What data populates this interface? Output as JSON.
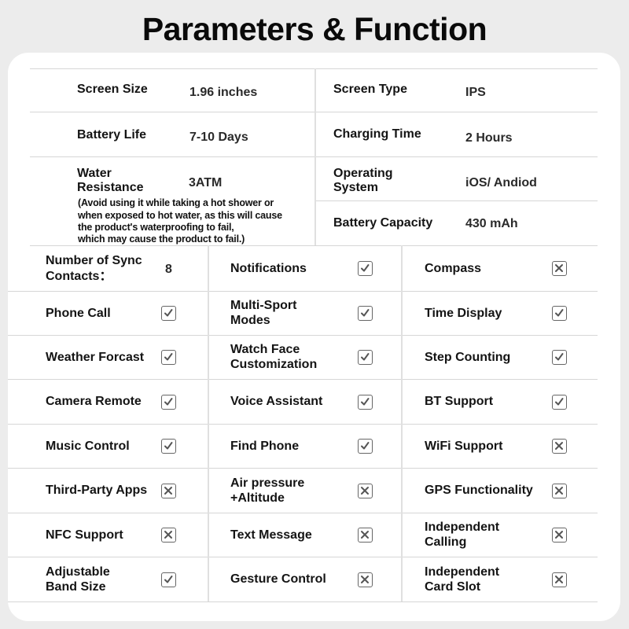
{
  "title": "Parameters & Function",
  "specs": [
    {
      "label": "Screen Size",
      "value": "1.96 inches"
    },
    {
      "label": "Screen Type",
      "value": "IPS"
    },
    {
      "label": "Battery Life",
      "value": "7-10 Days"
    },
    {
      "label": "Charging Time",
      "value": "2 Hours"
    },
    {
      "label": "Water Resistance",
      "label_lines": [
        "Water",
        "Resistance"
      ],
      "value": "3ATM",
      "note_lines": [
        "(Avoid using it while taking a hot shower or",
        "when exposed to hot water, as this will cause",
        "the product's waterproofing to fail,",
        "which may cause the product to fail.)"
      ]
    },
    {
      "label": "Operating System",
      "label_lines": [
        "Operating",
        "System"
      ],
      "value": "iOS/ Andiod"
    },
    {
      "label": "Battery Capacity",
      "value": "430 mAh"
    }
  ],
  "sync_contacts": {
    "label_lines": [
      "Number of Sync",
      "Contacts："
    ],
    "value": "8"
  },
  "features": [
    {
      "label": "Notifications",
      "supported": true
    },
    {
      "label": "Compass",
      "supported": false
    },
    {
      "label": "Phone Call",
      "supported": true
    },
    {
      "label": "Multi-Sport Modes",
      "label_lines": [
        "Multi-Sport",
        "Modes"
      ],
      "supported": true
    },
    {
      "label": "Time Display",
      "supported": true
    },
    {
      "label": "Weather Forcast",
      "supported": true
    },
    {
      "label": "Watch Face Customization",
      "label_lines": [
        "Watch Face",
        "Customization"
      ],
      "supported": true
    },
    {
      "label": "Step Counting",
      "supported": true
    },
    {
      "label": "Camera Remote",
      "supported": true
    },
    {
      "label": "Voice Assistant",
      "supported": true
    },
    {
      "label": "BT Support",
      "supported": true
    },
    {
      "label": "Music Control",
      "supported": true
    },
    {
      "label": "Find Phone",
      "supported": true
    },
    {
      "label": "WiFi Support",
      "supported": false
    },
    {
      "label": "Third-Party Apps",
      "supported": false
    },
    {
      "label": "Air pressure +Altitude",
      "label_lines": [
        "Air pressure",
        "+Altitude"
      ],
      "supported": false
    },
    {
      "label": "GPS Functionality",
      "supported": false
    },
    {
      "label": "NFC Support",
      "supported": false
    },
    {
      "label": "Text Message",
      "supported": false
    },
    {
      "label": "Independent Calling",
      "label_lines": [
        "Independent",
        "Calling"
      ],
      "supported": false
    },
    {
      "label": "Adjustable Band Size",
      "label_lines": [
        "Adjustable",
        "Band Size"
      ],
      "supported": true
    },
    {
      "label": "Gesture Control",
      "supported": false
    },
    {
      "label": "Independent Card Slot",
      "label_lines": [
        "Independent",
        "Card Slot"
      ],
      "supported": false
    }
  ],
  "icons": {
    "supported": "checkbox-checked-icon",
    "unsupported": "checkbox-crossed-icon"
  },
  "colors": {
    "background": "#ececec",
    "card": "#ffffff",
    "icon": "#666666",
    "divider": "#d6d6d6"
  }
}
